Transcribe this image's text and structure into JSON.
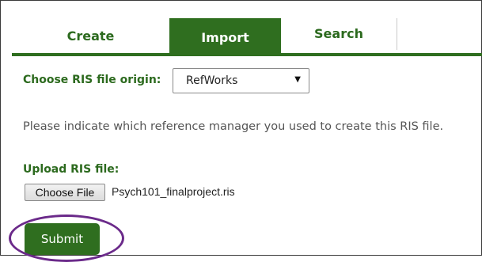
{
  "tabs": [
    {
      "label": "Create"
    },
    {
      "label": "Import",
      "active": true
    },
    {
      "label": "Search"
    }
  ],
  "form": {
    "origin_label": "Choose RIS file origin:",
    "origin_selected": "RefWorks",
    "help_text": "Please indicate which reference manager you used to create this RIS file.",
    "upload_label": "Upload RIS file:",
    "choose_file_label": "Choose File",
    "file_name": "Psych101_finalproject.ris",
    "submit_label": "Submit"
  },
  "colors": {
    "accent": "#2f6e1f",
    "highlight": "#6b2a8a"
  },
  "icons": {
    "dropdown": "chevron-down-icon"
  }
}
